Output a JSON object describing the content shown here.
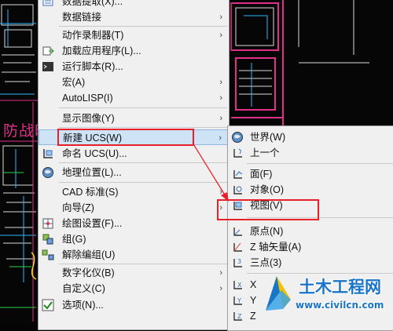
{
  "background": {
    "stray_text": "防战时"
  },
  "main_menu": {
    "items": [
      {
        "label": "数据提取(X)...",
        "icon": "data-extract-icon",
        "arrow": false
      },
      {
        "label": "数据链接",
        "icon": "",
        "arrow": true
      },
      {
        "label": "动作录制器(T)",
        "icon": "",
        "arrow": true
      },
      {
        "label": "加载应用程序(L)...",
        "icon": "load-app-icon",
        "arrow": false
      },
      {
        "label": "运行脚本(R)...",
        "icon": "script-icon",
        "arrow": false
      },
      {
        "label": "宏(A)",
        "icon": "",
        "arrow": true
      },
      {
        "label": "AutoLISP(I)",
        "icon": "",
        "arrow": true
      },
      {
        "label": "显示图像(Y)",
        "icon": "",
        "arrow": true
      },
      {
        "label": "新建 UCS(W)",
        "icon": "",
        "arrow": true
      },
      {
        "label": "命名 UCS(U)...",
        "icon": "named-ucs-icon",
        "arrow": false
      },
      {
        "label": "地理位置(L)...",
        "icon": "globe-icon",
        "arrow": false
      },
      {
        "label": "CAD 标准(S)",
        "icon": "",
        "arrow": true
      },
      {
        "label": "向导(Z)",
        "icon": "",
        "arrow": true
      },
      {
        "label": "绘图设置(F)...",
        "icon": "drafting-settings-icon",
        "arrow": false
      },
      {
        "label": "组(G)",
        "icon": "group-icon",
        "arrow": false
      },
      {
        "label": "解除编组(U)",
        "icon": "ungroup-icon",
        "arrow": false
      },
      {
        "label": "数字化仪(B)",
        "icon": "",
        "arrow": true
      },
      {
        "label": "自定义(C)",
        "icon": "",
        "arrow": true
      },
      {
        "label": "选项(N)...",
        "icon": "options-check-icon",
        "arrow": false
      }
    ],
    "arrow_glyph": "›"
  },
  "sub_menu": {
    "items": [
      {
        "label": "世界(W)",
        "icon": "world-ucs-icon"
      },
      {
        "label": "上一个",
        "icon": "previous-ucs-icon"
      },
      {
        "label": "面(F)",
        "icon": "face-ucs-icon"
      },
      {
        "label": "对象(O)",
        "icon": "object-ucs-icon"
      },
      {
        "label": "视图(V)",
        "icon": "view-ucs-icon"
      },
      {
        "label": "原点(N)",
        "icon": "origin-ucs-icon"
      },
      {
        "label": "Z 轴矢量(A)",
        "icon": "z-axis-vector-icon"
      },
      {
        "label": "三点(3)",
        "icon": "three-point-icon"
      },
      {
        "label": "X",
        "icon": "x-rotate-icon"
      },
      {
        "label": "Y",
        "icon": "y-rotate-icon"
      },
      {
        "label": "Z",
        "icon": "z-rotate-icon"
      }
    ]
  },
  "highlighted": {
    "main": "新建 UCS(W)",
    "sub": "视图(V)"
  },
  "colors": {
    "menu_bg": "#f0f0f0",
    "highlight": "#cfe3f7",
    "annotation_red": "#e8202a",
    "watermark_blue": "#1a74c8"
  },
  "watermark": {
    "title": "土木工程网",
    "url": "www.civilcn.com"
  }
}
